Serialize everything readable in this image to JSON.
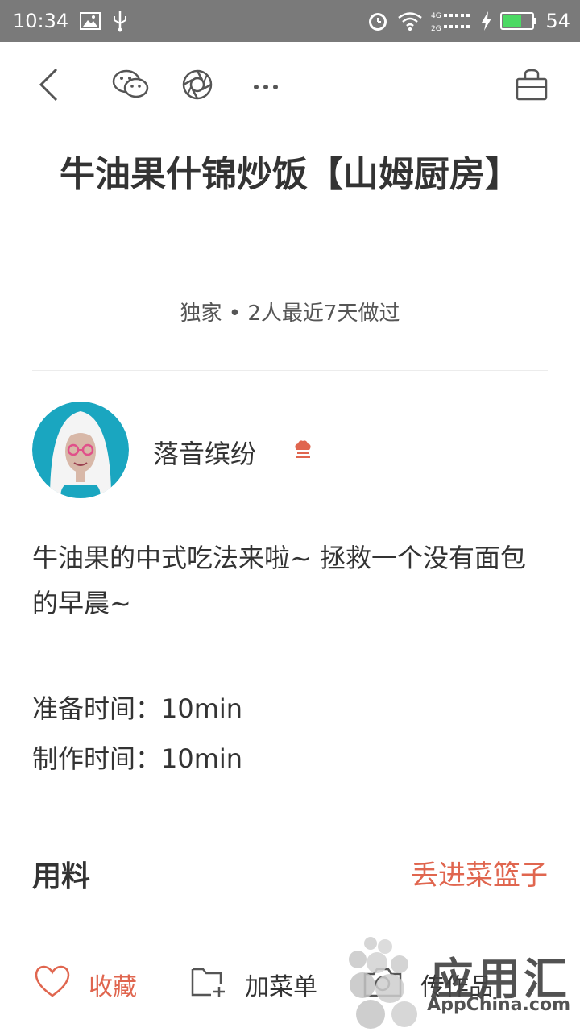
{
  "status_bar": {
    "time": "10:34",
    "network_labels": [
      "4G",
      "2G"
    ],
    "battery": "54"
  },
  "toolbar": {
    "icons": [
      "back-arrow-icon",
      "wechat-icon",
      "moments-icon",
      "more-dots-icon",
      "shopping-basket-icon"
    ]
  },
  "recipe": {
    "title": "牛油果什锦炒饭【山姆厨房】",
    "meta": "独家 • 2人最近7天做过",
    "author": "落音缤纷",
    "description": "牛油果的中式吃法来啦~ 拯救一个没有面包的早晨~",
    "prep_time": "准备时间：10min",
    "cook_time": "制作时间：10min"
  },
  "ingredients": {
    "title": "用料",
    "basket_link": "丢进菜篮子"
  },
  "bottom_bar": {
    "favorite": "收藏",
    "add_menu": "加菜单",
    "upload": "传作品"
  },
  "watermark": {
    "text": "应用汇",
    "sub": "AppChina.com"
  },
  "colors": {
    "accent": "#e0664f",
    "status_bar": "#7a7a7a",
    "avatar_bg": "#1aa6c0",
    "text": "#333333"
  }
}
